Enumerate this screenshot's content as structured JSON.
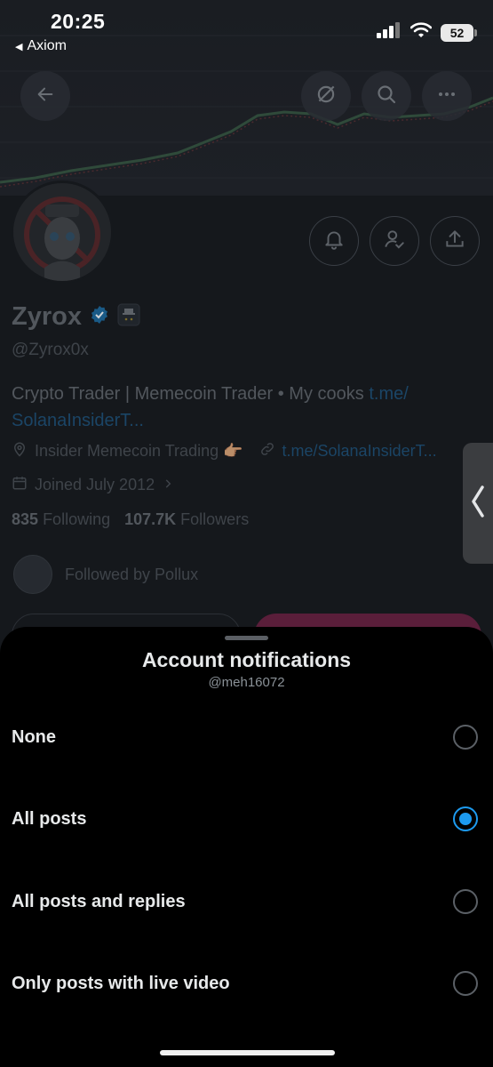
{
  "status_bar": {
    "time": "20:25",
    "back_app": "Axiom",
    "battery": "52",
    "icons": [
      "cellular-signal-icon",
      "wifi-icon",
      "battery-icon"
    ]
  },
  "header": {
    "back_icon": "arrow-left-icon",
    "action_icons": [
      "grok-slash-icon",
      "search-icon",
      "more-icon"
    ]
  },
  "profile": {
    "name": "Zyrox",
    "handle": "@Zyrox0x",
    "bio_text": "Crypto Trader | Memecoin Trader • My cooks ",
    "bio_link": "t.me/\nSolanaInsiderT...",
    "location": "Insider Memecoin Trading 👉🏽",
    "website": "t.me/SolanaInsiderT...",
    "joined": "Joined July 2012",
    "following_count": "835",
    "following_label": "Following",
    "followers_count": "107.7K",
    "followers_label": "Followers",
    "followed_by": "Followed by Pollux",
    "action_icons": [
      "notification-bell-icon",
      "user-check-icon",
      "share-icon"
    ]
  },
  "sheet": {
    "title": "Account notifications",
    "subtitle": "@meh16072",
    "options": [
      {
        "label": "None",
        "selected": false
      },
      {
        "label": "All posts",
        "selected": true
      },
      {
        "label": "All posts and replies",
        "selected": false
      },
      {
        "label": "Only posts with live video",
        "selected": false
      }
    ]
  },
  "colors": {
    "accent": "#1d9bf0",
    "sheet_bg": "#000000",
    "dim_text": "#52575d"
  }
}
